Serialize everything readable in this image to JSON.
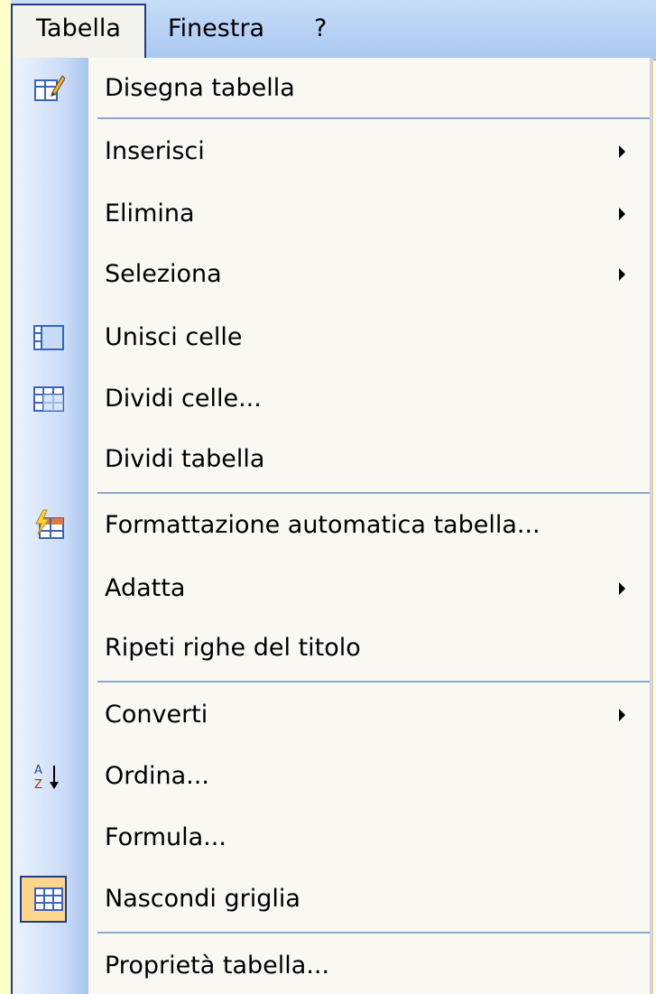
{
  "menubar": {
    "tabella": "Tabella",
    "finestra": "Finestra",
    "help": "?"
  },
  "menu": {
    "items": [
      {
        "label": "Disegna tabella",
        "icon": "pencil-table-icon",
        "submenu": false
      },
      {
        "label": "Inserisci",
        "icon": "",
        "submenu": true
      },
      {
        "label": "Elimina",
        "icon": "",
        "submenu": true
      },
      {
        "label": "Seleziona",
        "icon": "",
        "submenu": true
      },
      {
        "label": "Unisci celle",
        "icon": "merge-cells-icon",
        "submenu": false
      },
      {
        "label": "Dividi celle...",
        "icon": "split-cells-icon",
        "submenu": false
      },
      {
        "label": "Dividi tabella",
        "icon": "",
        "submenu": false
      },
      {
        "label": "Formattazione automatica tabella...",
        "icon": "autoformat-table-icon",
        "submenu": false
      },
      {
        "label": "Adatta",
        "icon": "",
        "submenu": true
      },
      {
        "label": "Ripeti righe del titolo",
        "icon": "",
        "submenu": false
      },
      {
        "label": "Converti",
        "icon": "",
        "submenu": true
      },
      {
        "label": "Ordina...",
        "icon": "sort-az-icon",
        "submenu": false
      },
      {
        "label": "Formula...",
        "icon": "",
        "submenu": false
      },
      {
        "label": "Nascondi griglia",
        "icon": "hide-grid-icon",
        "submenu": false
      },
      {
        "label": "Proprietà tabella...",
        "icon": "",
        "submenu": false
      }
    ]
  },
  "colors": {
    "background": "#ffffcc",
    "menubar": "#a9c8f1",
    "menu": "#f9f8f3",
    "border": "#1f3d88",
    "highlight": "#ffd68c"
  }
}
